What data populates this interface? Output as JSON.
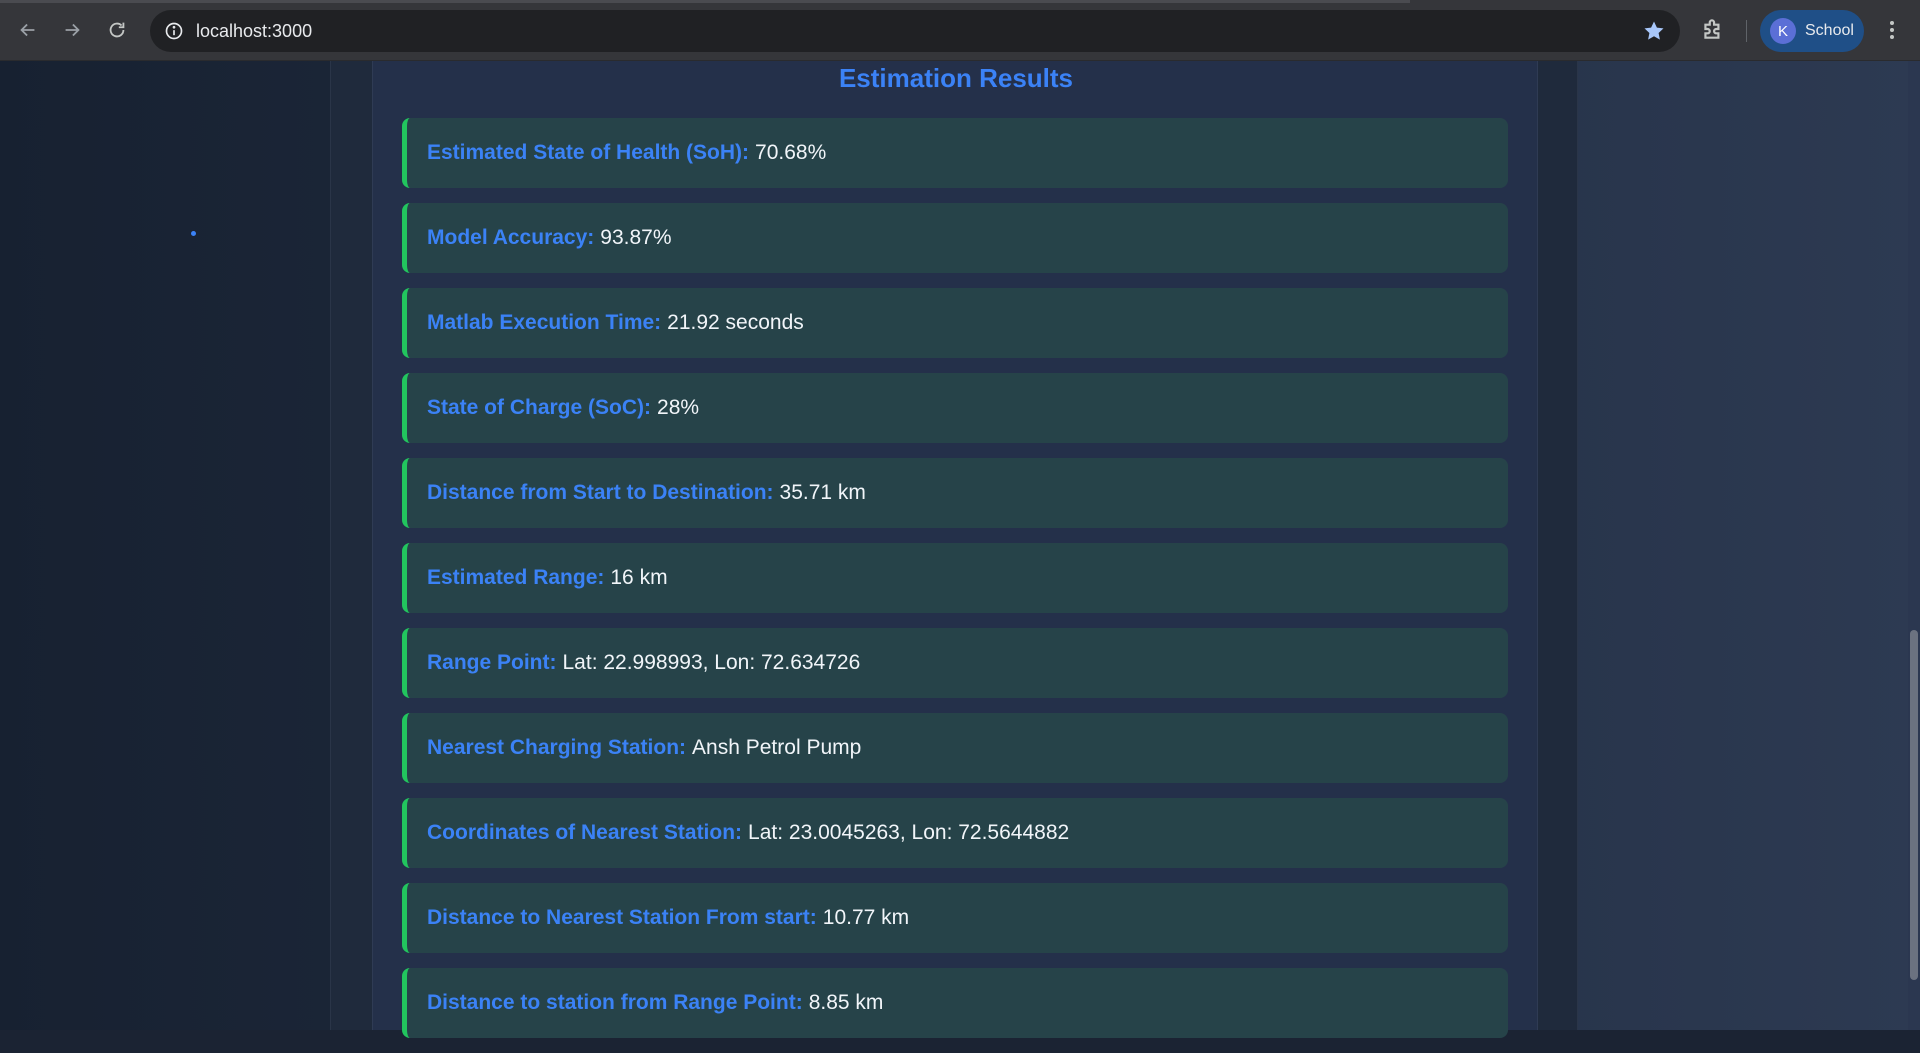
{
  "browser": {
    "url": "localhost:3000",
    "profile_initial": "K",
    "profile_name": "School"
  },
  "results": {
    "title": "Estimation Results",
    "items": [
      {
        "label": "Estimated State of Health (SoH):",
        "value": "70.68%"
      },
      {
        "label": "Model Accuracy:",
        "value": "93.87%"
      },
      {
        "label": "Matlab Execution Time:",
        "value": "21.92 seconds"
      },
      {
        "label": "State of Charge (SoC):",
        "value": "28%"
      },
      {
        "label": "Distance from Start to Destination:",
        "value": "35.71 km"
      },
      {
        "label": "Estimated Range:",
        "value": "16 km"
      },
      {
        "label": "Range Point:",
        "value": "Lat: 22.998993, Lon: 72.634726"
      },
      {
        "label": "Nearest Charging Station:",
        "value": "Ansh Petrol Pump"
      },
      {
        "label": "Coordinates of Nearest Station:",
        "value": "Lat: 23.0045263, Lon: 72.5644882"
      },
      {
        "label": "Distance to Nearest Station From start:",
        "value": "10.77 km"
      },
      {
        "label": "Distance to station from Range Point:",
        "value": "8.85 km"
      }
    ]
  },
  "colors": {
    "accent_label": "#3b82f6",
    "item_border": "#22c55e",
    "item_bg": "#264349"
  },
  "icons": {
    "back": "arrow-left-icon",
    "forward": "arrow-right-icon",
    "reload": "reload-icon",
    "site_info": "info-icon",
    "bookmark": "star-icon",
    "extensions": "puzzle-icon",
    "menu": "kebab-menu-icon"
  }
}
